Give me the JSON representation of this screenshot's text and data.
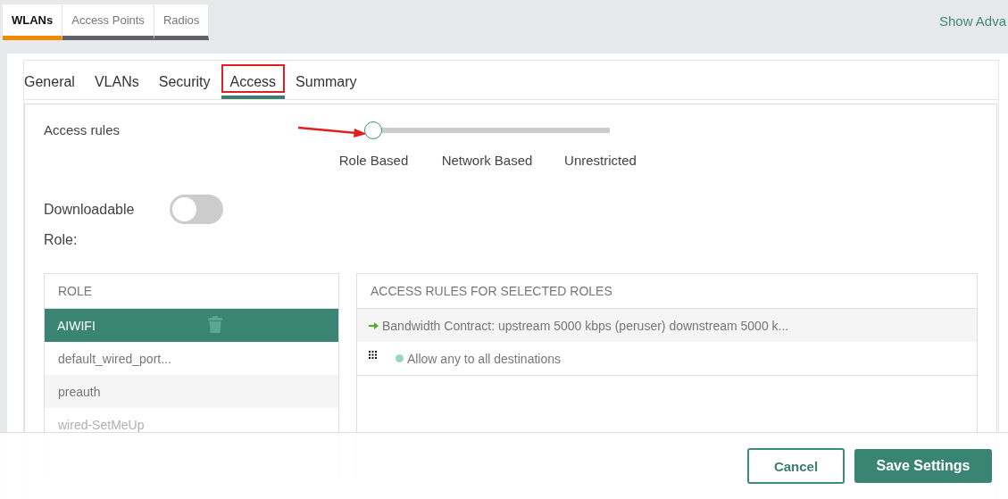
{
  "top_tabs": [
    {
      "label": "WLANs",
      "selected": true
    },
    {
      "label": "Access Points",
      "selected": false
    },
    {
      "label": "Radios",
      "selected": false
    }
  ],
  "show_advanced_link": "Show Adva",
  "steps": [
    {
      "label": "General",
      "selected": false,
      "annotated": false
    },
    {
      "label": "VLANs",
      "selected": false,
      "annotated": false
    },
    {
      "label": "Security",
      "selected": false,
      "annotated": false
    },
    {
      "label": "Access",
      "selected": true,
      "annotated": true
    },
    {
      "label": "Summary",
      "selected": false,
      "annotated": false
    }
  ],
  "access_rules": {
    "label": "Access rules",
    "level": 0,
    "annotated": true,
    "stops": [
      "Role Based",
      "Network Based",
      "Unrestricted"
    ]
  },
  "downloadable_role": {
    "label": "Downloadable Role:",
    "on": false
  },
  "roles": {
    "header": "ROLE",
    "items": [
      {
        "name": "AIWIFI",
        "selected": true
      },
      {
        "name": "default_wired_port...",
        "selected": false
      },
      {
        "name": "preauth",
        "selected": false
      },
      {
        "name": "wired-SetMeUp",
        "selected": false
      }
    ]
  },
  "rules": {
    "header": "ACCESS RULES FOR SELECTED ROLES",
    "items": [
      {
        "kind": "bandwidth",
        "text": "Bandwidth Contract: upstream 5000 kbps (peruser) downstream 5000 k..."
      },
      {
        "kind": "acl",
        "text": "Allow any to all destinations"
      }
    ]
  },
  "buttons": {
    "cancel": "Cancel",
    "save": "Save Settings"
  }
}
